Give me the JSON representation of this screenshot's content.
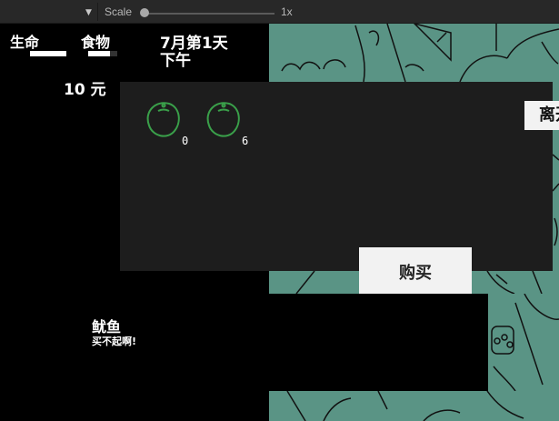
{
  "toolbar": {
    "scale_label": "Scale",
    "scale_value": "1x",
    "dropdown_icon": "triangle-down-icon"
  },
  "hud": {
    "life_label": "生命",
    "food_label": "食物",
    "life_level": 1.0,
    "food_level": 0.75,
    "date_line1": "7月第1天",
    "date_line2": "下午",
    "money": "10 元"
  },
  "shop": {
    "items": [
      {
        "icon": "lime-fruit-icon",
        "count": "0"
      },
      {
        "icon": "lime-fruit-icon",
        "count": "6"
      }
    ],
    "leave_label": "离开",
    "buy_label": "购买"
  },
  "dialog": {
    "speaker": "鱿鱼",
    "text": "买不起啊!"
  },
  "colors": {
    "background": "#000000",
    "scene_green": "#5a9485",
    "panel": "#1d1d1d",
    "button": "#f2f2f2",
    "fruit_stroke": "#3aa04a"
  }
}
